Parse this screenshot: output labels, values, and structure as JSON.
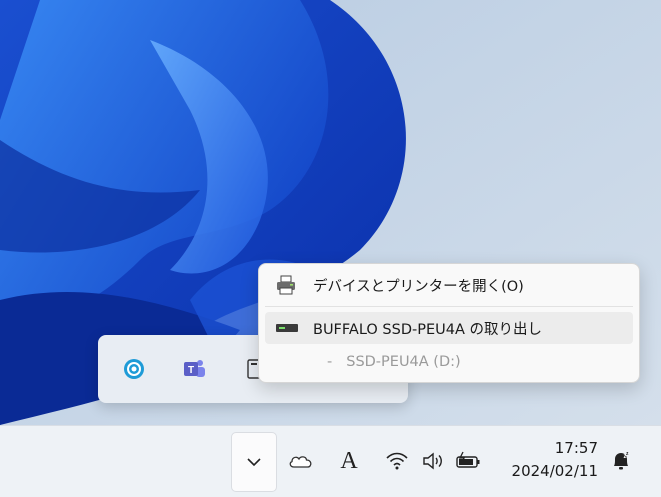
{
  "context_menu": {
    "items": [
      {
        "label": "デバイスとプリンターを開く(O)",
        "icon": "printer-icon"
      },
      {
        "label": "BUFFALO SSD-PEU4A の取り出し",
        "icon": "drive-icon"
      }
    ],
    "sub_item": {
      "dash": "-",
      "label": "SSD-PEU4A (D:)"
    }
  },
  "tray_overflow": {
    "icons": [
      "sync-icon",
      "teams-icon",
      "usb-drive-icon"
    ]
  },
  "taskbar": {
    "ime_label": "A",
    "time": "17:57",
    "date": "2024/02/11",
    "icons": [
      "chevron-up-icon",
      "onedrive-icon",
      "wifi-icon",
      "volume-icon",
      "battery-icon",
      "notification-bell-icon"
    ]
  },
  "colors": {
    "accent": "#1757d6",
    "teams": "#5b5fc7",
    "sync": "#1e9bd7"
  }
}
